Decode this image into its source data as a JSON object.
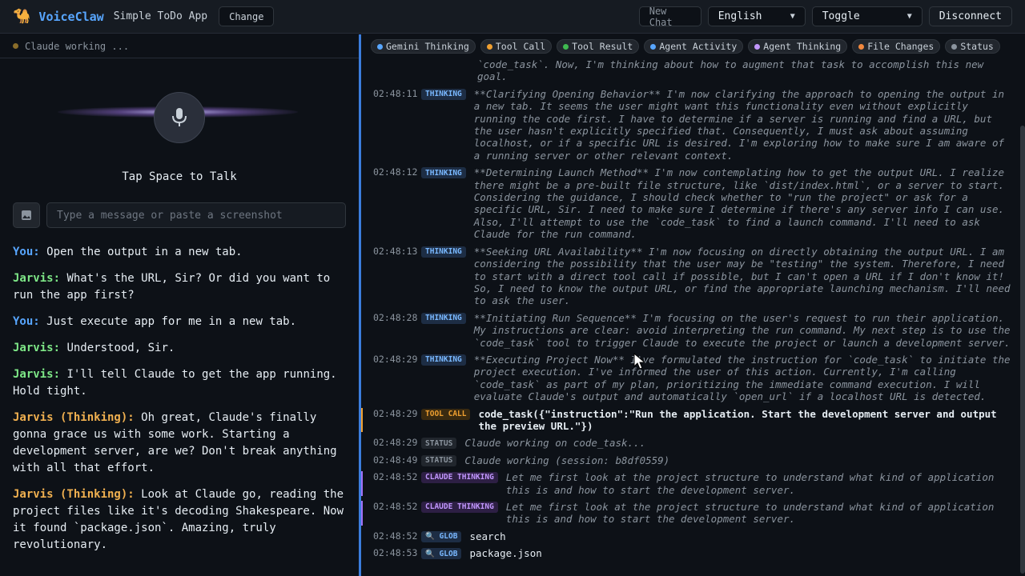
{
  "topbar": {
    "logo_emoji": "🐪",
    "app_name": "VoiceClaw",
    "project": "Simple ToDo App",
    "change_label": "Change",
    "new_chat_label": "New Chat",
    "language": "English",
    "mode": "Toggle",
    "disconnect_label": "Disconnect"
  },
  "left": {
    "status_text": "Claude working ...",
    "status_color": "#8a6d2a",
    "tap_label": "Tap Space to Talk",
    "input_placeholder": "Type a message or paste a screenshot",
    "messages": [
      {
        "speaker": "You:",
        "kind": "you",
        "text": "Open the output in a new tab."
      },
      {
        "speaker": "Jarvis:",
        "kind": "jarvis",
        "text": "What's the URL, Sir? Or did you want to run the app first?"
      },
      {
        "speaker": "You:",
        "kind": "you",
        "text": "Just execute app for me in a new tab."
      },
      {
        "speaker": "Jarvis:",
        "kind": "jarvis",
        "text": "Understood, Sir."
      },
      {
        "speaker": "Jarvis:",
        "kind": "jarvis",
        "text": "I'll tell Claude to get the app running. Hold tight."
      },
      {
        "speaker": "Jarvis (Thinking):",
        "kind": "think",
        "text": "Oh great, Claude's finally gonna grace us with some work. Starting a development server, are we? Don't break anything with all that effort."
      },
      {
        "speaker": "Jarvis (Thinking):",
        "kind": "think",
        "text": "Look at Claude go, reading the project files like it's decoding Shakespeare. Now it found `package.json`. Amazing, truly revolutionary."
      }
    ]
  },
  "filters": [
    {
      "label": "Gemini Thinking",
      "color": "#58a6ff"
    },
    {
      "label": "Tool Call",
      "color": "#f0a030"
    },
    {
      "label": "Tool Result",
      "color": "#3fb950"
    },
    {
      "label": "Agent Activity",
      "color": "#58a6ff"
    },
    {
      "label": "Agent Thinking",
      "color": "#c297ff"
    },
    {
      "label": "File Changes",
      "color": "#f0883e"
    },
    {
      "label": "Status",
      "color": "#8b949e"
    }
  ],
  "log": [
    {
      "ts": "",
      "badge": "",
      "type": "think",
      "text": "`code_task`. Now, I'm thinking about how to augment that task to accomplish this new goal."
    },
    {
      "ts": "02:48:11",
      "badge": "THINKING",
      "type": "think",
      "text": "**Clarifying Opening Behavior** I'm now clarifying the approach to opening the output in a new tab. It seems the user might want this functionality even without explicitly running the code first. I have to determine if a server is running and find a URL, but the user hasn't explicitly specified that. Consequently, I must ask about assuming localhost, or if a specific URL is desired. I'm exploring how to make sure I am aware of a running server or other relevant context."
    },
    {
      "ts": "02:48:12",
      "badge": "THINKING",
      "type": "think",
      "text": "**Determining Launch Method** I'm now contemplating how to get the output URL. I realize there might be a pre-built file structure, like `dist/index.html`, or a server to start. Considering the guidance, I should check whether to \"run the project\" or ask for a specific URL, Sir. I need to make sure I determine if there's any server info I can use. Also, I'll attempt to use the `code_task` to find a launch command. I'll need to ask Claude for the run command."
    },
    {
      "ts": "02:48:13",
      "badge": "THINKING",
      "type": "think",
      "text": "**Seeking URL Availability** I'm now focusing on directly obtaining the output URL. I am considering the possibility that the user may be \"testing\" the system. Therefore, I need to start with a direct tool call if possible, but I can't open a URL if I don't know it! So, I need to know the output URL, or find the appropriate launching mechanism. I'll need to ask the user."
    },
    {
      "ts": "02:48:28",
      "badge": "THINKING",
      "type": "think",
      "text": "**Initiating Run Sequence** I'm focusing on the user's request to run their application. My instructions are clear: avoid interpreting the run command. My next step is to use the `code_task` tool to trigger Claude to execute the project or launch a development server."
    },
    {
      "ts": "02:48:29",
      "badge": "THINKING",
      "type": "think",
      "text": "**Executing Project Now** I've formulated the instruction for `code_task` to initiate the project execution. I've informed the user of this action. Currently, I'm calling `code_task` as part of my plan, prioritizing the immediate command execution. I will evaluate Claude's output and automatically `open_url` if a localhost URL is detected."
    },
    {
      "ts": "02:48:29",
      "badge": "TOOL CALL",
      "type": "tool",
      "text": "code_task({\"instruction\":\"Run the application. Start the development server and output the preview URL.\"})"
    },
    {
      "ts": "02:48:29",
      "badge": "STATUS",
      "type": "status",
      "text": "Claude working on code_task..."
    },
    {
      "ts": "02:48:49",
      "badge": "STATUS",
      "type": "status",
      "text": "Claude working (session: b8df0559)"
    },
    {
      "ts": "02:48:52",
      "badge": "CLAUDE THINKING",
      "type": "claude",
      "text": "Let me first look at the project structure to understand what kind of application this is and how to start the development server."
    },
    {
      "ts": "02:48:52",
      "badge": "CLAUDE THINKING",
      "type": "claude",
      "text": "Let me first look at the project structure to understand what kind of application this is and how to start the development server."
    },
    {
      "ts": "02:48:52",
      "badge": "🔍 GLOB",
      "type": "glob",
      "text": "search"
    },
    {
      "ts": "02:48:53",
      "badge": "🔍 GLOB",
      "type": "glob",
      "text": "package.json"
    }
  ]
}
